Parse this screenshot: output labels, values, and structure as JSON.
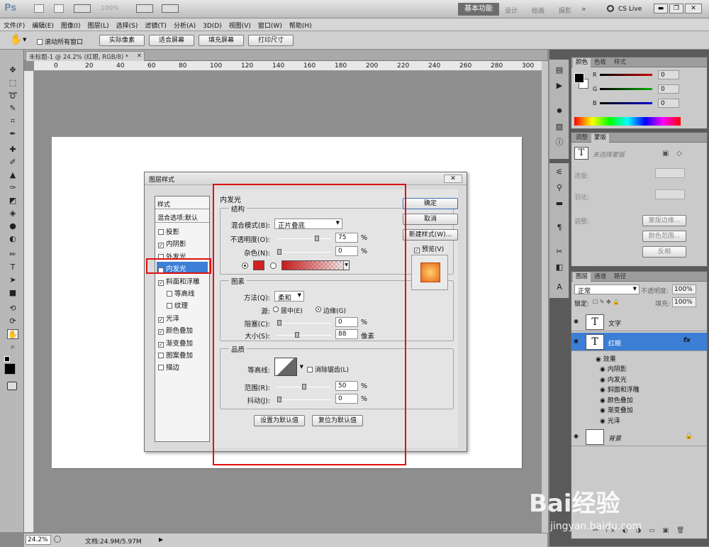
{
  "app": {
    "logo": "Ps",
    "zoom_top": "100%",
    "workspace_active": "基本功能",
    "workspaces": [
      "设计",
      "绘画",
      "摄影"
    ],
    "cslive": "CS Live"
  },
  "menu": [
    "文件(F)",
    "编辑(E)",
    "图像(I)",
    "图层(L)",
    "选择(S)",
    "滤镜(T)",
    "分析(A)",
    "3D(D)",
    "视图(V)",
    "窗口(W)",
    "帮助(H)"
  ],
  "options": {
    "scroll_all": "滚动所有窗口",
    "buttons": [
      "实际像素",
      "适合屏幕",
      "填充屏幕",
      "打印尺寸"
    ]
  },
  "document": {
    "tab": "未标题-1 @ 24.2% (红眼, RGB/8) *",
    "ruler_ticks": [
      "0",
      "20",
      "40",
      "60",
      "80",
      "100",
      "120",
      "140",
      "160",
      "180",
      "200",
      "220",
      "240",
      "260",
      "280",
      "300"
    ],
    "status_zoom": "24.2%",
    "status_doc": "文档:24.9M/5.97M"
  },
  "dialog": {
    "title": "图层样式",
    "styles_header": "样式",
    "blend_default": "混合选项:默认",
    "styles": [
      {
        "label": "投影",
        "checked": false,
        "sub": false,
        "active": false
      },
      {
        "label": "内阴影",
        "checked": true,
        "sub": false,
        "active": false
      },
      {
        "label": "外发光",
        "checked": false,
        "sub": false,
        "active": false
      },
      {
        "label": "内发光",
        "checked": true,
        "sub": false,
        "active": true
      },
      {
        "label": "斜面和浮雕",
        "checked": true,
        "sub": false,
        "active": false
      },
      {
        "label": "等高线",
        "checked": false,
        "sub": true,
        "active": false
      },
      {
        "label": "纹理",
        "checked": false,
        "sub": true,
        "active": false
      },
      {
        "label": "光泽",
        "checked": true,
        "sub": false,
        "active": false
      },
      {
        "label": "颜色叠加",
        "checked": true,
        "sub": false,
        "active": false
      },
      {
        "label": "渐变叠加",
        "checked": true,
        "sub": false,
        "active": false
      },
      {
        "label": "图案叠加",
        "checked": false,
        "sub": false,
        "active": false
      },
      {
        "label": "描边",
        "checked": false,
        "sub": false,
        "active": false
      }
    ],
    "section": "内发光",
    "structure": {
      "title": "结构",
      "blend_label": "混合模式(B):",
      "blend_value": "正片叠底",
      "opacity_label": "不透明度(O):",
      "opacity": "75",
      "noise_label": "杂色(N):",
      "noise": "0",
      "pct": "%",
      "opacity_frac": 0.75,
      "noise_frac": 0.0,
      "glow_color": "#d42020"
    },
    "elements": {
      "title": "图素",
      "method_label": "方法(Q):",
      "method_value": "柔和",
      "source_label": "源:",
      "center": "居中(E)",
      "edge": "边缘(G)",
      "choke_label": "阻塞(C):",
      "choke": "0",
      "size_label": "大小(S):",
      "size": "88",
      "unit_px": "像素",
      "choke_frac": 0.0,
      "size_frac": 0.35
    },
    "quality": {
      "title": "品质",
      "contour_label": "等高线:",
      "antialias": "消除锯齿(L)",
      "range_label": "范围(R):",
      "range": "50",
      "jitter_label": "抖动(J):",
      "jitter": "0",
      "range_frac": 0.5,
      "jitter_frac": 0.0
    },
    "btn_default": "设置为默认值",
    "btn_reset": "复位为默认值",
    "ok": "确定",
    "cancel": "取消",
    "new_style": "新建样式(W)...",
    "preview": "预览(V)"
  },
  "color_panel": {
    "tabs": [
      "颜色",
      "色板",
      "样式"
    ],
    "channels": [
      {
        "name": "R",
        "value": "0",
        "color": "#d00000"
      },
      {
        "name": "G",
        "value": "0",
        "color": "#00b000"
      },
      {
        "name": "B",
        "value": "0",
        "color": "#0000d0"
      }
    ]
  },
  "adjust_panel": {
    "tabs": [
      "调整",
      "蒙版"
    ],
    "no_mask": "未选择蒙版",
    "density": "浓度:",
    "feather": "羽化:",
    "refine": "调整:",
    "mask_edge": "蒙版边缘...",
    "color_range": "颜色范围...",
    "invert": "反相"
  },
  "layers_panel": {
    "tabs": [
      "图层",
      "通道",
      "路径"
    ],
    "blend": "正常",
    "opacity_label": "不透明度:",
    "opacity": "100%",
    "lock_label": "锁定:",
    "fill_label": "填充:",
    "fill": "100%",
    "layers": [
      {
        "name": "文字",
        "thumb": "T",
        "selected": false
      },
      {
        "name": "红眼",
        "thumb": "T",
        "selected": true,
        "fx": "fx"
      }
    ],
    "effects_label": "效果",
    "effects": [
      "内阴影",
      "内发光",
      "斜面和浮雕",
      "颜色叠加",
      "渐变叠加",
      "光泽"
    ],
    "background": "背景"
  },
  "watermark": {
    "text": "Bai经验",
    "url": "jingyan.baidu.com"
  }
}
